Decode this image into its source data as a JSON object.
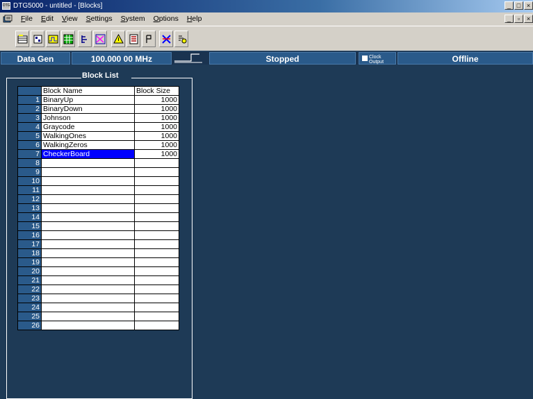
{
  "window": {
    "title": "DTG5000 - untitled - [Blocks]",
    "app_icon_text": "DTG"
  },
  "menu": {
    "items": [
      {
        "label": "File",
        "ul": "F",
        "rest": "ile"
      },
      {
        "label": "Edit",
        "ul": "E",
        "rest": "dit"
      },
      {
        "label": "View",
        "ul": "V",
        "rest": "iew"
      },
      {
        "label": "Settings",
        "ul": "S",
        "rest": "ettings"
      },
      {
        "label": "System",
        "ul": "S",
        "rest": "ystem"
      },
      {
        "label": "Options",
        "ul": "O",
        "rest": "ptions"
      },
      {
        "label": "Help",
        "ul": "H",
        "rest": "elp"
      }
    ]
  },
  "toolbar": {
    "icons": [
      "blocks-icon",
      "pattern-icon",
      "waveform-icon",
      "grid-icon",
      "sequence-icon",
      "jump-icon",
      "warning-icon",
      "signal-icon",
      "connect-icon",
      "marker-icon",
      "timing-icon"
    ]
  },
  "status": {
    "mode": "Data Gen",
    "clock_freq": "100.000 00 MHz",
    "run_state": "Stopped",
    "clock_output_line1": "Clock",
    "clock_output_line2": "Output",
    "connection": "Offline"
  },
  "block_list": {
    "legend": "Block List",
    "columns": [
      "Block Name",
      "Block Size"
    ],
    "rows": [
      {
        "num": "1",
        "name": "BinaryUp",
        "size": "1000"
      },
      {
        "num": "2",
        "name": "BinaryDown",
        "size": "1000"
      },
      {
        "num": "3",
        "name": "Johnson",
        "size": "1000"
      },
      {
        "num": "4",
        "name": "Graycode",
        "size": "1000"
      },
      {
        "num": "5",
        "name": "WalkingOnes",
        "size": "1000"
      },
      {
        "num": "6",
        "name": "WalkingZeros",
        "size": "1000"
      },
      {
        "num": "7",
        "name": "CheckerBoard",
        "size": "1000",
        "selected": true
      },
      {
        "num": "8",
        "name": "",
        "size": ""
      },
      {
        "num": "9",
        "name": "",
        "size": ""
      },
      {
        "num": "10",
        "name": "",
        "size": ""
      },
      {
        "num": "11",
        "name": "",
        "size": ""
      },
      {
        "num": "12",
        "name": "",
        "size": ""
      },
      {
        "num": "13",
        "name": "",
        "size": ""
      },
      {
        "num": "14",
        "name": "",
        "size": ""
      },
      {
        "num": "15",
        "name": "",
        "size": ""
      },
      {
        "num": "16",
        "name": "",
        "size": ""
      },
      {
        "num": "17",
        "name": "",
        "size": ""
      },
      {
        "num": "18",
        "name": "",
        "size": ""
      },
      {
        "num": "19",
        "name": "",
        "size": ""
      },
      {
        "num": "20",
        "name": "",
        "size": ""
      },
      {
        "num": "21",
        "name": "",
        "size": ""
      },
      {
        "num": "22",
        "name": "",
        "size": ""
      },
      {
        "num": "23",
        "name": "",
        "size": ""
      },
      {
        "num": "24",
        "name": "",
        "size": ""
      },
      {
        "num": "25",
        "name": "",
        "size": ""
      },
      {
        "num": "26",
        "name": "",
        "size": ""
      }
    ]
  }
}
